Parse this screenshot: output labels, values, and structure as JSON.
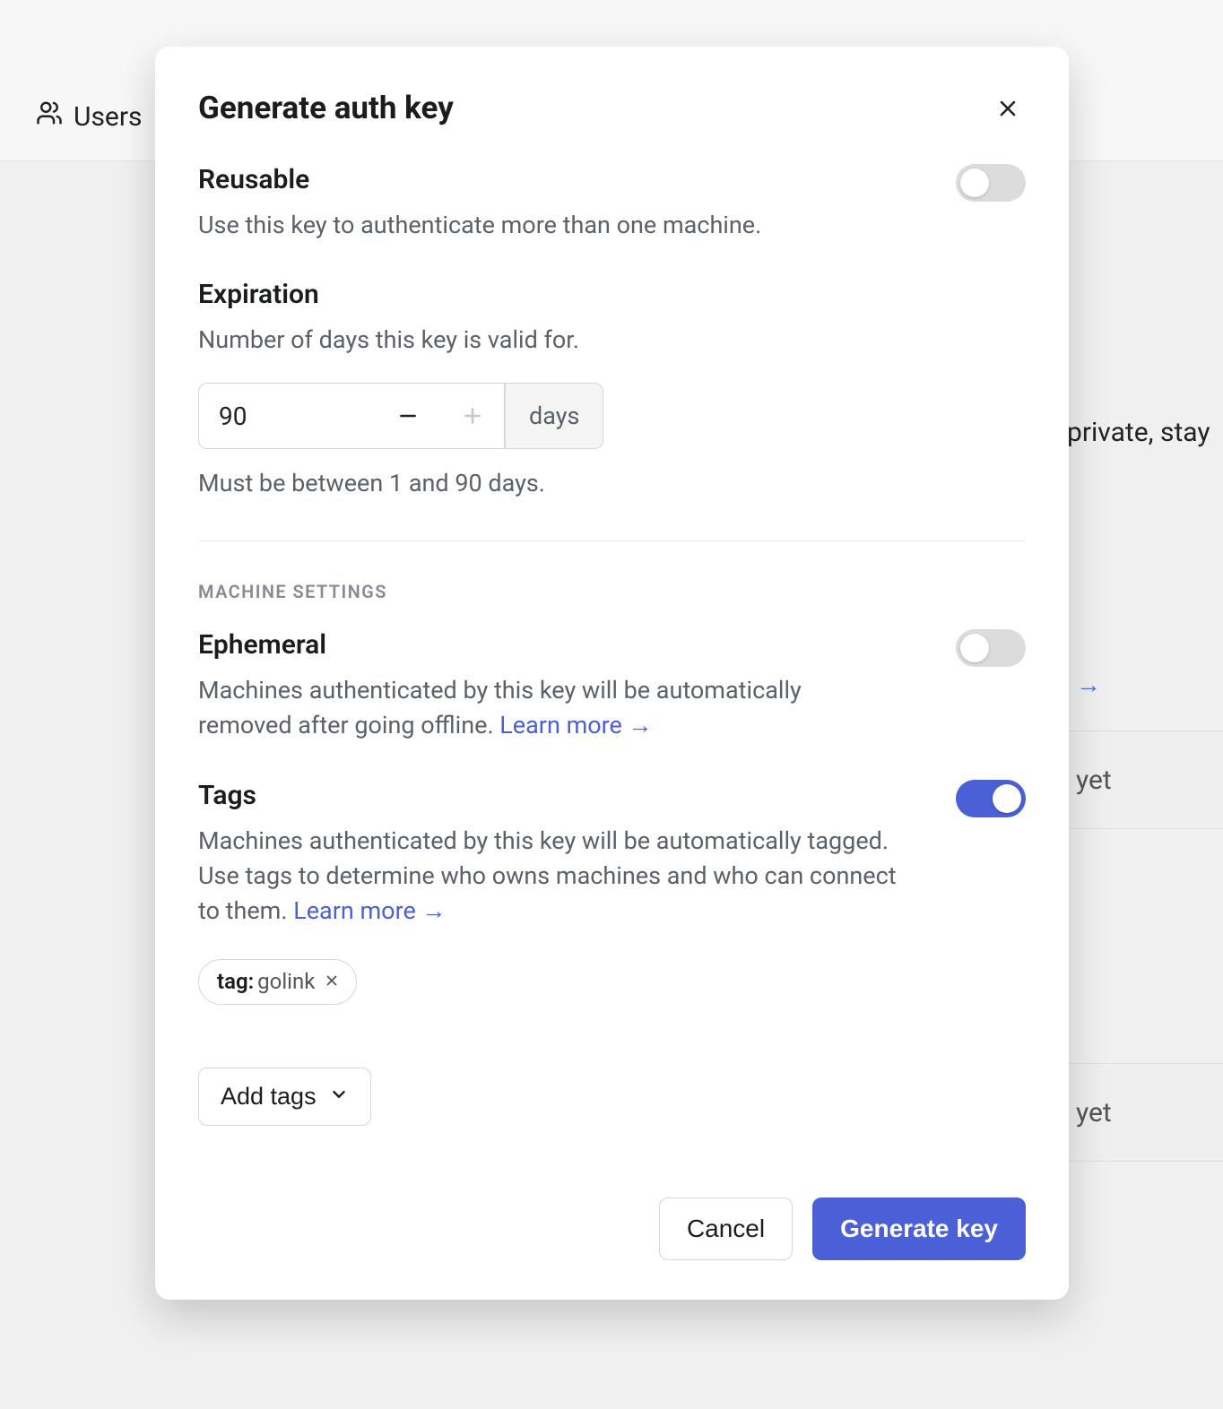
{
  "background": {
    "nav_item_users": "Users",
    "partial_text_right": "private, stay",
    "arrow_symbol": "→",
    "row_text_1": "yet",
    "row_text_2": "yet"
  },
  "modal": {
    "title": "Generate auth key",
    "reusable": {
      "title": "Reusable",
      "desc": "Use this key to authenticate more than one machine.",
      "enabled": false
    },
    "expiration": {
      "title": "Expiration",
      "desc": "Number of days this key is valid for.",
      "value": "90",
      "unit": "days",
      "helper": "Must be between 1 and 90 days."
    },
    "machine_section_heading": "MACHINE SETTINGS",
    "ephemeral": {
      "title": "Ephemeral",
      "desc": "Machines authenticated by this key will be automatically removed after going offline. ",
      "learn_more": "Learn more →",
      "enabled": false
    },
    "tags": {
      "title": "Tags",
      "desc": "Machines authenticated by this key will be automatically tagged. Use tags to determine who owns machines and who can connect to them. ",
      "learn_more": "Learn more →",
      "enabled": true,
      "items": [
        {
          "prefix": "tag:",
          "name": "golink"
        }
      ],
      "add_button": "Add tags"
    },
    "footer": {
      "cancel": "Cancel",
      "generate": "Generate key"
    }
  }
}
